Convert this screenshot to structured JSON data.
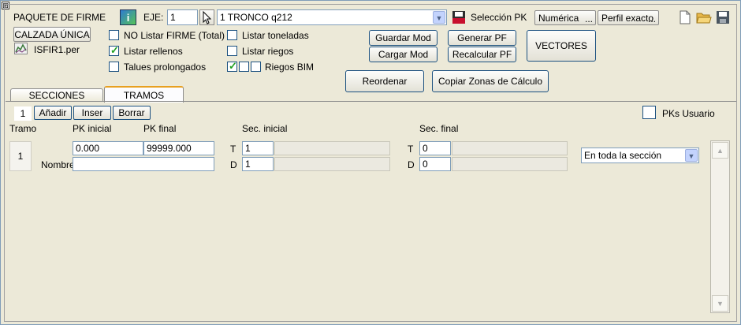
{
  "header": {
    "title": "PAQUETE DE FIRME",
    "calzada_label": "CALZADA ÚNICA",
    "file_name": "ISFIR1.per",
    "eje_label": "EJE:",
    "eje_value": "1",
    "axis_selected": "1 TRONCO q212",
    "seleccion_pk_label": "Selección PK",
    "numerica_label": "Numérica",
    "perfil_label": "Perfil exacto",
    "dots": "..."
  },
  "options": {
    "no_listar_firme": {
      "label": "NO Listar FIRME (Total)",
      "checked": false
    },
    "listar_rellenos": {
      "label": "Listar rellenos",
      "checked": true
    },
    "talues_prolongados": {
      "label": "Talues prolongados",
      "checked": false
    },
    "listar_toneladas": {
      "label": "Listar toneladas",
      "checked": false
    },
    "listar_riegos": {
      "label": "Listar riegos",
      "checked": false
    },
    "riegos_bim": {
      "label": "Riegos BIM"
    }
  },
  "buttons": {
    "guardar_mod": "Guardar Mod",
    "cargar_mod": "Cargar Mod",
    "generar_pf": "Generar PF",
    "recalcular_pf": "Recalcular PF",
    "vectores": "VECTORES",
    "reordenar": "Reordenar",
    "copiar_zonas": "Copiar Zonas de Cálculo"
  },
  "tabs": [
    {
      "label": "SECCIONES",
      "active": false
    },
    {
      "label": "TRAMOS",
      "active": true
    }
  ],
  "tramos": {
    "count": "1",
    "anadir": "Añadir",
    "inser": "Inser",
    "borrar": "Borrar",
    "pks_usuario_label": "PKs Usuario",
    "headers": {
      "tramo": "Tramo",
      "pk_inicial": "PK inicial",
      "pk_final": "PK final",
      "sec_inicial": "Sec. inicial",
      "sec_final": "Sec. final"
    },
    "row": {
      "number": "1",
      "pk_inicial": "0.000",
      "pk_final": "99999.000",
      "nombre_label": "Nombre",
      "nombre_value": "",
      "t_label": "T",
      "d_label": "D",
      "sec_ini_t": "1",
      "sec_ini_d": "1",
      "sec_fin_t": "0",
      "sec_fin_d": "0",
      "zona_selected": "En toda la sección"
    }
  }
}
